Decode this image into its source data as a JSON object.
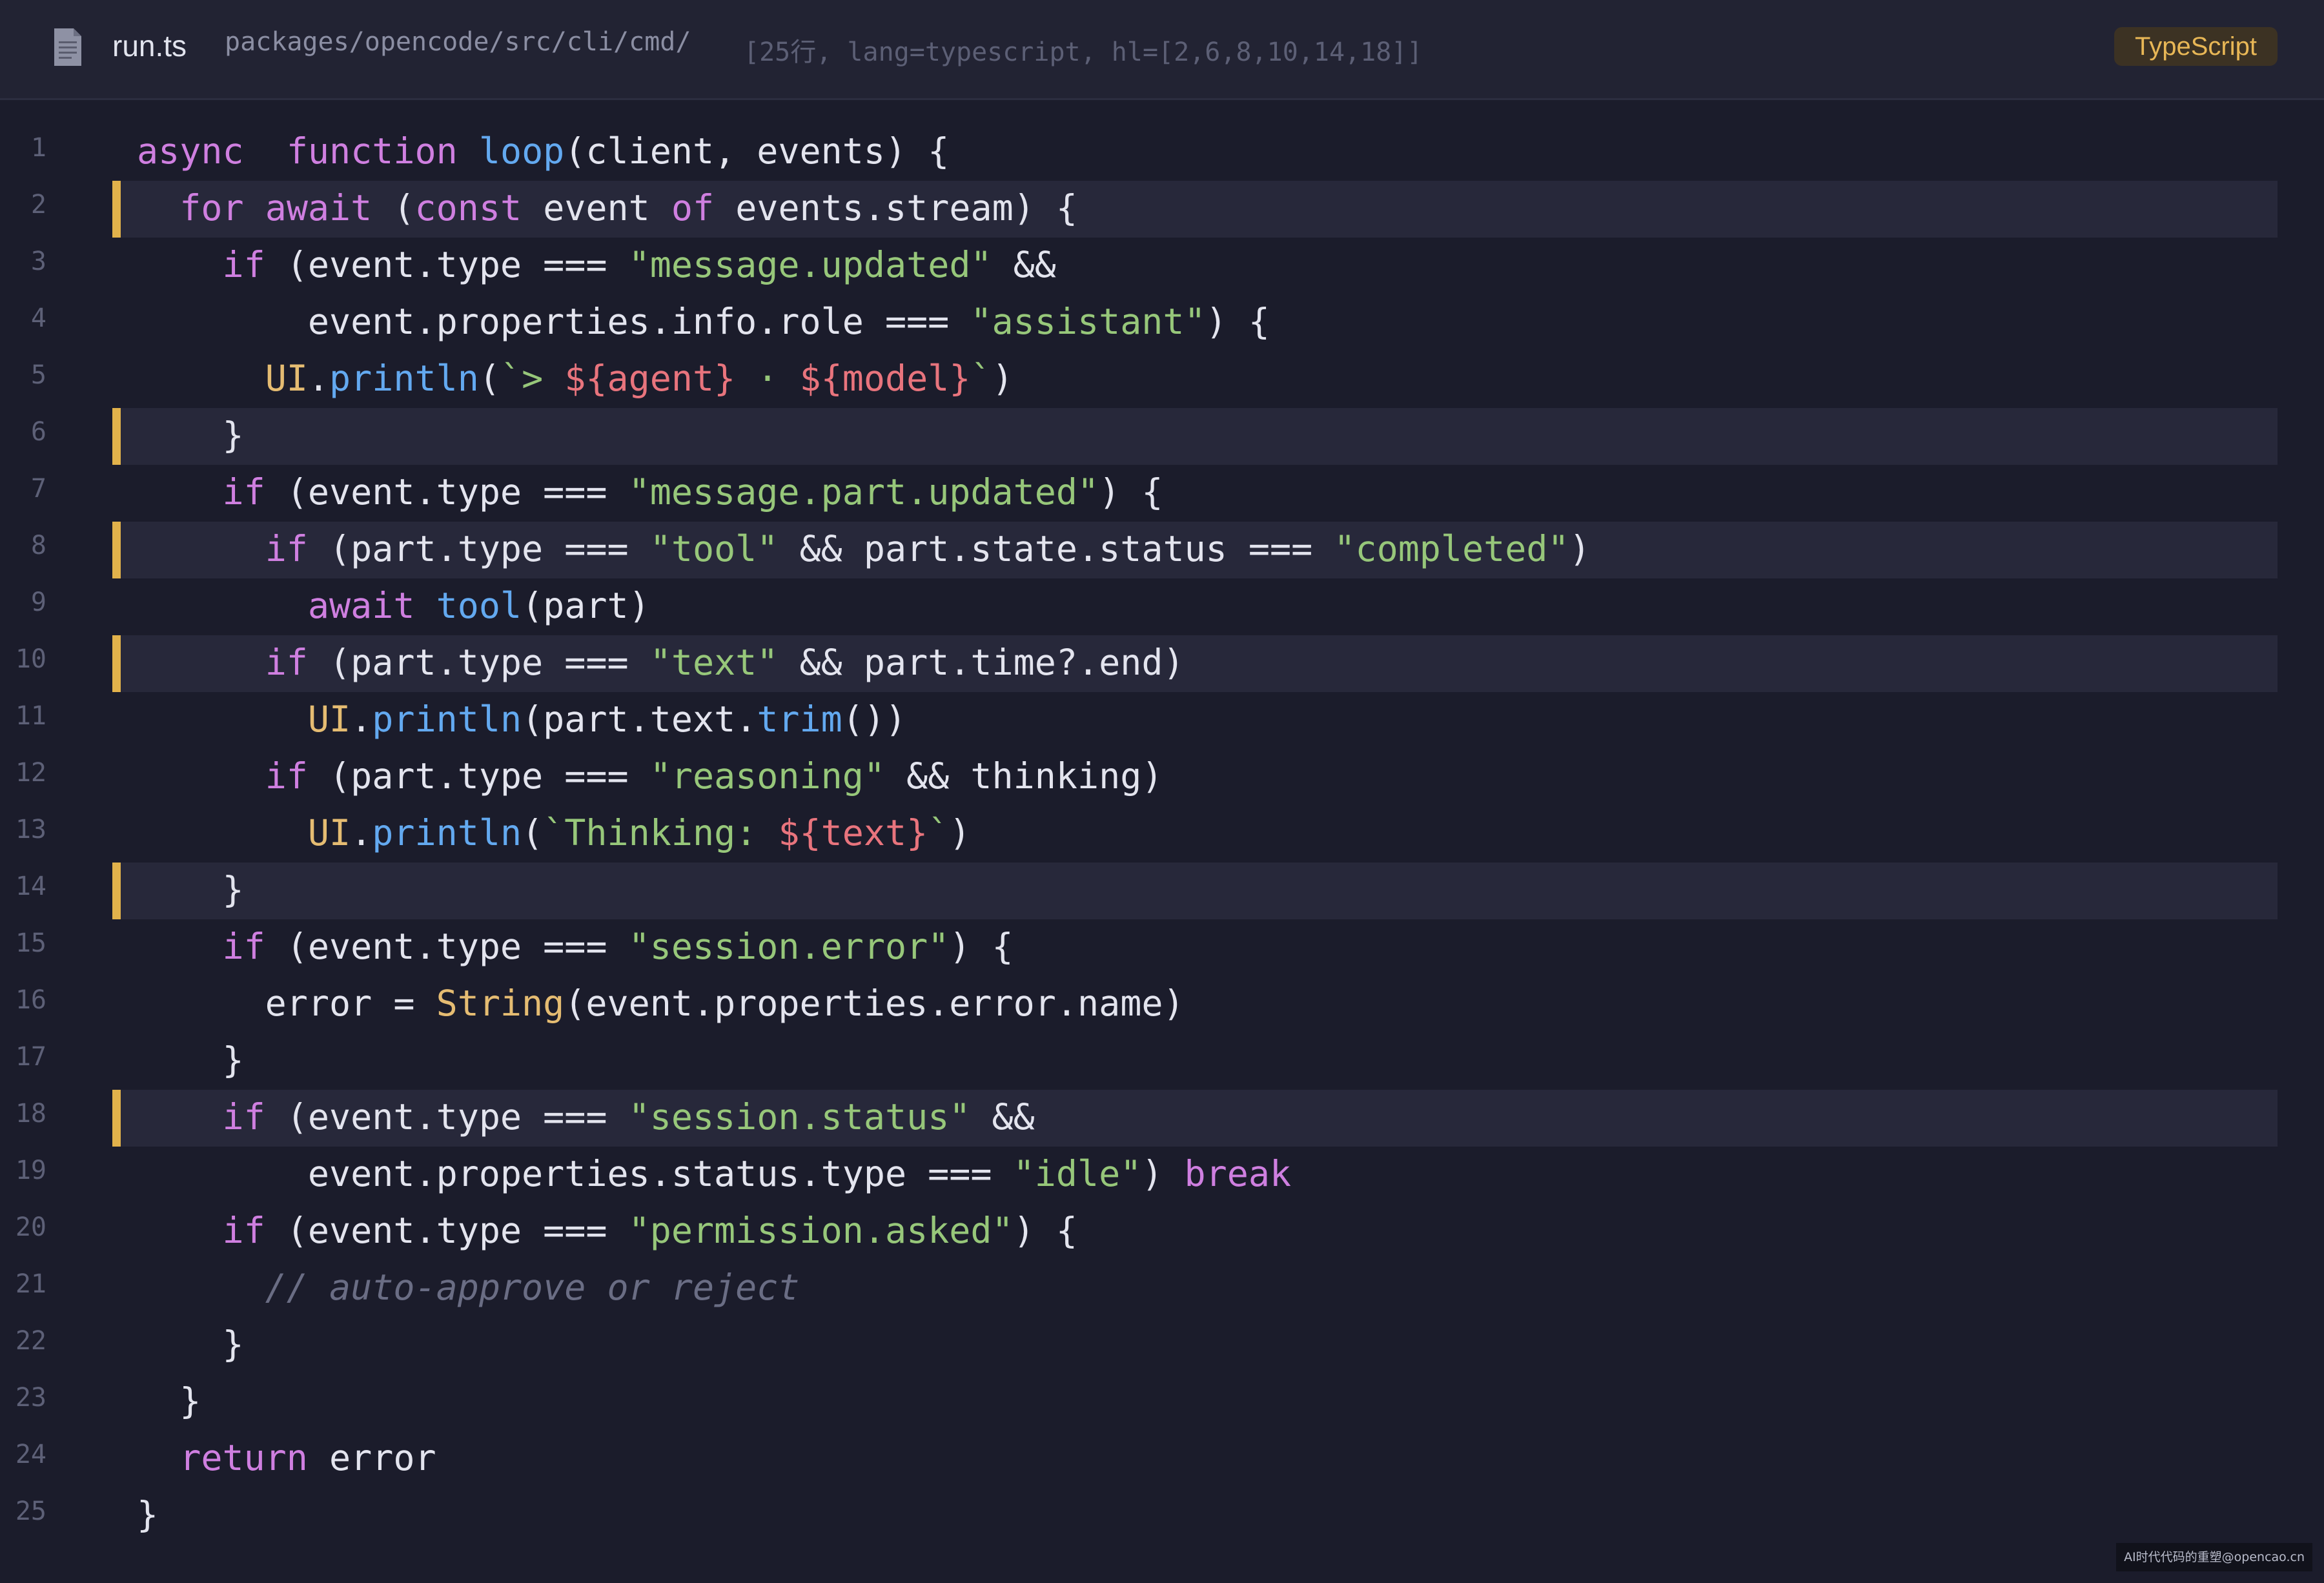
{
  "header": {
    "filename": "run.ts",
    "path": "packages/opencode/src/cli/cmd/",
    "meta": "[25行, lang=typescript, hl=[2,6,8,10,14,18]]",
    "language_badge": "TypeScript",
    "file_icon": "document-icon"
  },
  "colors": {
    "background": "#1b1c2b",
    "keyword": "#cf7fe0",
    "function": "#63a9f0",
    "string": "#97c77a",
    "comment": "#6a6d84",
    "type": "#e5bc72",
    "highlight_bar": "#e2b24b"
  },
  "highlighted_lines": [
    2,
    6,
    8,
    10,
    14,
    18
  ],
  "lines": [
    {
      "n": "1",
      "tokens": [
        [
          "k",
          "async"
        ],
        [
          "",
          "  "
        ],
        [
          "k",
          "function"
        ],
        [
          "",
          " "
        ],
        [
          "f",
          "loop"
        ],
        [
          "",
          "(client, events) {"
        ]
      ]
    },
    {
      "n": "2",
      "tokens": [
        [
          "",
          "  "
        ],
        [
          "k",
          "for"
        ],
        [
          "",
          " "
        ],
        [
          "k",
          "await"
        ],
        [
          "",
          " ("
        ],
        [
          "k",
          "const"
        ],
        [
          "",
          " event "
        ],
        [
          "k",
          "of"
        ],
        [
          "",
          " events.stream) {"
        ]
      ]
    },
    {
      "n": "3",
      "tokens": [
        [
          "",
          "    "
        ],
        [
          "k",
          "if"
        ],
        [
          "",
          " (event.type "
        ],
        [
          "",
          "==="
        ],
        [
          "",
          " "
        ],
        [
          "s",
          "\"message.updated\""
        ],
        [
          "",
          " &&"
        ]
      ]
    },
    {
      "n": "4",
      "tokens": [
        [
          "",
          "        event.properties.info.role === "
        ],
        [
          "s",
          "\"assistant\""
        ],
        [
          "",
          ") {"
        ]
      ]
    },
    {
      "n": "5",
      "tokens": [
        [
          "",
          "      "
        ],
        [
          "t",
          "UI"
        ],
        [
          "",
          "."
        ],
        [
          "f",
          "println"
        ],
        [
          "",
          "("
        ],
        [
          "s",
          "`> "
        ],
        [
          "te",
          "${agent}"
        ],
        [
          "s",
          " · "
        ],
        [
          "te",
          "${model}"
        ],
        [
          "s",
          "`"
        ],
        [
          "",
          ")"
        ]
      ]
    },
    {
      "n": "6",
      "tokens": [
        [
          "",
          "    }"
        ]
      ]
    },
    {
      "n": "7",
      "tokens": [
        [
          "",
          "    "
        ],
        [
          "k",
          "if"
        ],
        [
          "",
          " (event.type === "
        ],
        [
          "s",
          "\"message.part.updated\""
        ],
        [
          "",
          ") {"
        ]
      ]
    },
    {
      "n": "8",
      "tokens": [
        [
          "",
          "      "
        ],
        [
          "k",
          "if"
        ],
        [
          "",
          " (part.type === "
        ],
        [
          "s",
          "\"tool\""
        ],
        [
          "",
          " && part.state.status === "
        ],
        [
          "s",
          "\"completed\""
        ],
        [
          "",
          ")"
        ]
      ]
    },
    {
      "n": "9",
      "tokens": [
        [
          "",
          "        "
        ],
        [
          "k",
          "await"
        ],
        [
          "",
          " "
        ],
        [
          "f",
          "tool"
        ],
        [
          "",
          "(part)"
        ]
      ]
    },
    {
      "n": "10",
      "tokens": [
        [
          "",
          "      "
        ],
        [
          "k",
          "if"
        ],
        [
          "",
          " (part.type === "
        ],
        [
          "s",
          "\"text\""
        ],
        [
          "",
          " && part.time?.end)"
        ]
      ]
    },
    {
      "n": "11",
      "tokens": [
        [
          "",
          "        "
        ],
        [
          "t",
          "UI"
        ],
        [
          "",
          "."
        ],
        [
          "f",
          "println"
        ],
        [
          "",
          "(part.text."
        ],
        [
          "f",
          "trim"
        ],
        [
          "",
          "())"
        ]
      ]
    },
    {
      "n": "12",
      "tokens": [
        [
          "",
          "      "
        ],
        [
          "k",
          "if"
        ],
        [
          "",
          " (part.type === "
        ],
        [
          "s",
          "\"reasoning\""
        ],
        [
          "",
          " && thinking)"
        ]
      ]
    },
    {
      "n": "13",
      "tokens": [
        [
          "",
          "        "
        ],
        [
          "t",
          "UI"
        ],
        [
          "",
          "."
        ],
        [
          "f",
          "println"
        ],
        [
          "",
          "("
        ],
        [
          "s",
          "`Thinking: "
        ],
        [
          "te",
          "${text}"
        ],
        [
          "s",
          "`"
        ],
        [
          "",
          ")"
        ]
      ]
    },
    {
      "n": "14",
      "tokens": [
        [
          "",
          "    }"
        ]
      ]
    },
    {
      "n": "15",
      "tokens": [
        [
          "",
          "    "
        ],
        [
          "k",
          "if"
        ],
        [
          "",
          " (event.type === "
        ],
        [
          "s",
          "\"session.error\""
        ],
        [
          "",
          ") {"
        ]
      ]
    },
    {
      "n": "16",
      "tokens": [
        [
          "",
          "      error = "
        ],
        [
          "t",
          "String"
        ],
        [
          "",
          "(event.properties.error.name)"
        ]
      ]
    },
    {
      "n": "17",
      "tokens": [
        [
          "",
          "    }"
        ]
      ]
    },
    {
      "n": "18",
      "tokens": [
        [
          "",
          "    "
        ],
        [
          "k",
          "if"
        ],
        [
          "",
          " (event.type === "
        ],
        [
          "s",
          "\"session.status\""
        ],
        [
          "",
          " &&"
        ]
      ]
    },
    {
      "n": "19",
      "tokens": [
        [
          "",
          "        event.properties.status.type === "
        ],
        [
          "s",
          "\"idle\""
        ],
        [
          "",
          ") "
        ],
        [
          "k",
          "break"
        ]
      ]
    },
    {
      "n": "20",
      "tokens": [
        [
          "",
          "    "
        ],
        [
          "k",
          "if"
        ],
        [
          "",
          " (event.type === "
        ],
        [
          "s",
          "\"permission.asked\""
        ],
        [
          "",
          ") {"
        ]
      ]
    },
    {
      "n": "21",
      "tokens": [
        [
          "",
          "      "
        ],
        [
          "c",
          "// auto-approve or reject"
        ]
      ]
    },
    {
      "n": "22",
      "tokens": [
        [
          "",
          "    }"
        ]
      ]
    },
    {
      "n": "23",
      "tokens": [
        [
          "",
          "  }"
        ]
      ]
    },
    {
      "n": "24",
      "tokens": [
        [
          "",
          "  "
        ],
        [
          "k",
          "return"
        ],
        [
          "",
          " error"
        ]
      ]
    },
    {
      "n": "25",
      "tokens": [
        [
          "",
          "}"
        ]
      ]
    }
  ],
  "watermark": "AI时代代码的重塑@opencao.cn"
}
